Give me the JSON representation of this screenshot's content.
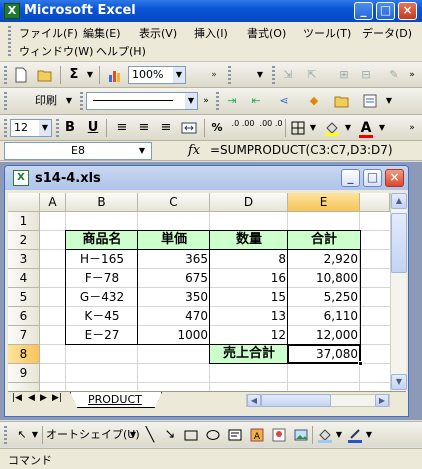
{
  "window": {
    "title": "Microsoft Excel",
    "min_glyph": "_",
    "max_glyph": "□",
    "close_glyph": "×"
  },
  "menu": {
    "row1": [
      "ファイル(F)",
      "編集(E)",
      "表示(V)",
      "挿入(I)",
      "書式(O)",
      "ツール(T)",
      "データ(D)"
    ],
    "row2": [
      "ウィンドウ(W)",
      "ヘルプ(H)"
    ]
  },
  "toolbar1": {
    "zoom": "100%",
    "sigma": "Σ"
  },
  "toolbar2": {
    "print_label": "印刷"
  },
  "toolbar3": {
    "font_size": "12",
    "bold": "B",
    "underline": "U",
    "percent": "%",
    "inc_decimal": ".0 .00",
    "dec_decimal": ".00 .0"
  },
  "formula_bar": {
    "cell_ref": "E8",
    "fx": "fx",
    "formula": "=SUMPRODUCT(C3:C7,D3:D7)"
  },
  "workbook": {
    "title": "s14-4.xls"
  },
  "sheet": {
    "columns": [
      "A",
      "B",
      "C",
      "D",
      "E"
    ],
    "rows": [
      "1",
      "2",
      "3",
      "4",
      "5",
      "6",
      "7",
      "8",
      "9"
    ],
    "header": {
      "b": "商品名",
      "c": "単価",
      "d": "数量",
      "e": "合計"
    },
    "data": [
      {
        "b": "H－165",
        "c": "365",
        "d": "8",
        "e": "2,920"
      },
      {
        "b": "F－78",
        "c": "675",
        "d": "16",
        "e": "10,800"
      },
      {
        "b": "G－432",
        "c": "350",
        "d": "15",
        "e": "5,250"
      },
      {
        "b": "K－45",
        "c": "470",
        "d": "13",
        "e": "6,110"
      },
      {
        "b": "E－27",
        "c": "1000",
        "d": "12",
        "e": "12,000"
      }
    ],
    "total_label": "売上合計",
    "total_value": "37,080",
    "active_cell": "E8",
    "header_fill": "#ccffcc",
    "selected_column_color": "#f9c35a"
  },
  "sheet_tab": {
    "label": "PRODUCT"
  },
  "draw_toolbar": {
    "autoshape_label": "オートシェイプ(U)"
  },
  "status": {
    "text": "コマンド"
  }
}
